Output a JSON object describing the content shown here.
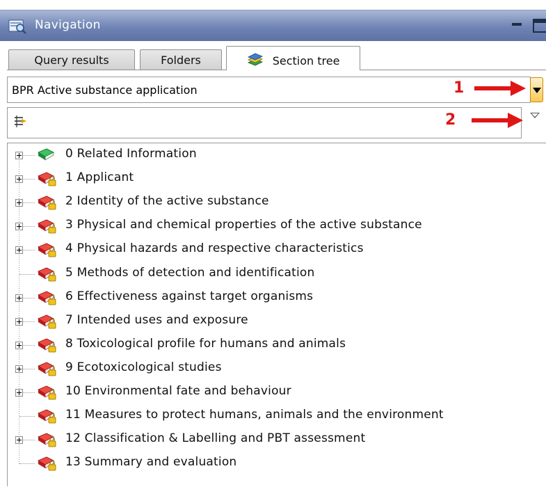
{
  "window": {
    "title": "Navigation",
    "icon": "navigation-icon",
    "controls": [
      "minimize-icon",
      "maximize-icon"
    ]
  },
  "tabs": [
    {
      "label": "Query results",
      "active": false
    },
    {
      "label": "Folders",
      "active": false
    },
    {
      "label": "Section tree",
      "active": true,
      "icon": "section-tree-icon"
    }
  ],
  "selector": {
    "value": "BPR Active substance application"
  },
  "filter": {
    "value": ""
  },
  "callouts": [
    "1",
    "2"
  ],
  "tree": {
    "nodes": [
      {
        "label": "0 Related Information",
        "icon": "green-book-icon",
        "expandable": true
      },
      {
        "label": "1 Applicant",
        "icon": "red-book-lock-icon",
        "expandable": true
      },
      {
        "label": "2 Identity of the active substance",
        "icon": "red-book-lock-icon",
        "expandable": true
      },
      {
        "label": "3 Physical and chemical properties of the active substance",
        "icon": "red-book-lock-icon",
        "expandable": true
      },
      {
        "label": "4 Physical hazards and respective characteristics",
        "icon": "red-book-lock-icon",
        "expandable": true
      },
      {
        "label": "5 Methods of detection and identification",
        "icon": "red-book-lock-icon",
        "expandable": false
      },
      {
        "label": "6 Effectiveness against target organisms",
        "icon": "red-book-lock-icon",
        "expandable": true
      },
      {
        "label": "7 Intended uses and exposure",
        "icon": "red-book-lock-icon",
        "expandable": true
      },
      {
        "label": "8 Toxicological profile for humans and animals",
        "icon": "red-book-lock-icon",
        "expandable": true
      },
      {
        "label": "9 Ecotoxicological studies",
        "icon": "red-book-lock-icon",
        "expandable": true
      },
      {
        "label": "10 Environmental fate and behaviour",
        "icon": "red-book-lock-icon",
        "expandable": true
      },
      {
        "label": "11 Measures to protect humans, animals and the environment",
        "icon": "red-book-lock-icon",
        "expandable": false
      },
      {
        "label": "12 Classification & Labelling and PBT assessment",
        "icon": "red-book-lock-icon",
        "expandable": true
      },
      {
        "label": "13 Summary and evaluation",
        "icon": "red-book-lock-icon",
        "expandable": false
      }
    ]
  },
  "colors": {
    "titlebar": "#6f84b4",
    "callout": "#e01616",
    "book_red": "#d8282a",
    "book_green": "#2aa84a"
  }
}
